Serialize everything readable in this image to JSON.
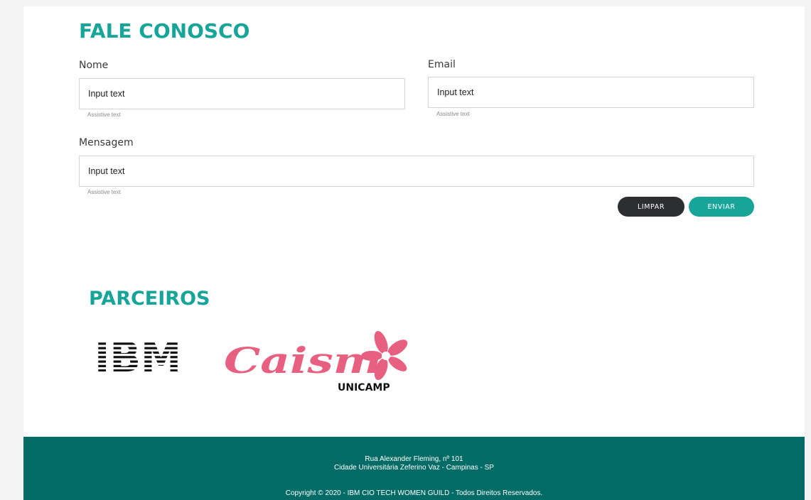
{
  "contact": {
    "title": "FALE CONOSCO",
    "name_label": "Nome",
    "name_placeholder": "Input text",
    "name_helper": "Assistive text",
    "email_label": "Email",
    "email_placeholder": "Input text",
    "email_helper": "Assistive text",
    "message_label": "Mensagem",
    "message_placeholder": "Input text",
    "message_helper": "Assistive text",
    "clear_label": "LIMPAR",
    "send_label": "ENVIAR"
  },
  "partners": {
    "title": "PARCEIROS",
    "logos": [
      {
        "name": "IBM",
        "text": "IBM"
      },
      {
        "name": "Caism Unicamp",
        "text": "Caism",
        "subtext": "UNICAMP"
      }
    ]
  },
  "footer": {
    "address_line1": "Rua Alexander Fleming, nº 101",
    "address_line2": "Cidade Universitária Zeferino Vaz - Campinas - SP",
    "copyright": "Copyright © 2020 - IBM CIO TECH WOMEN GUILD - Todos Direitos Reservados."
  },
  "colors": {
    "accent": "#17a59a",
    "footer_bg": "#036b66",
    "dark_button": "#2d2e30",
    "caism_pink": "#e8607f"
  }
}
